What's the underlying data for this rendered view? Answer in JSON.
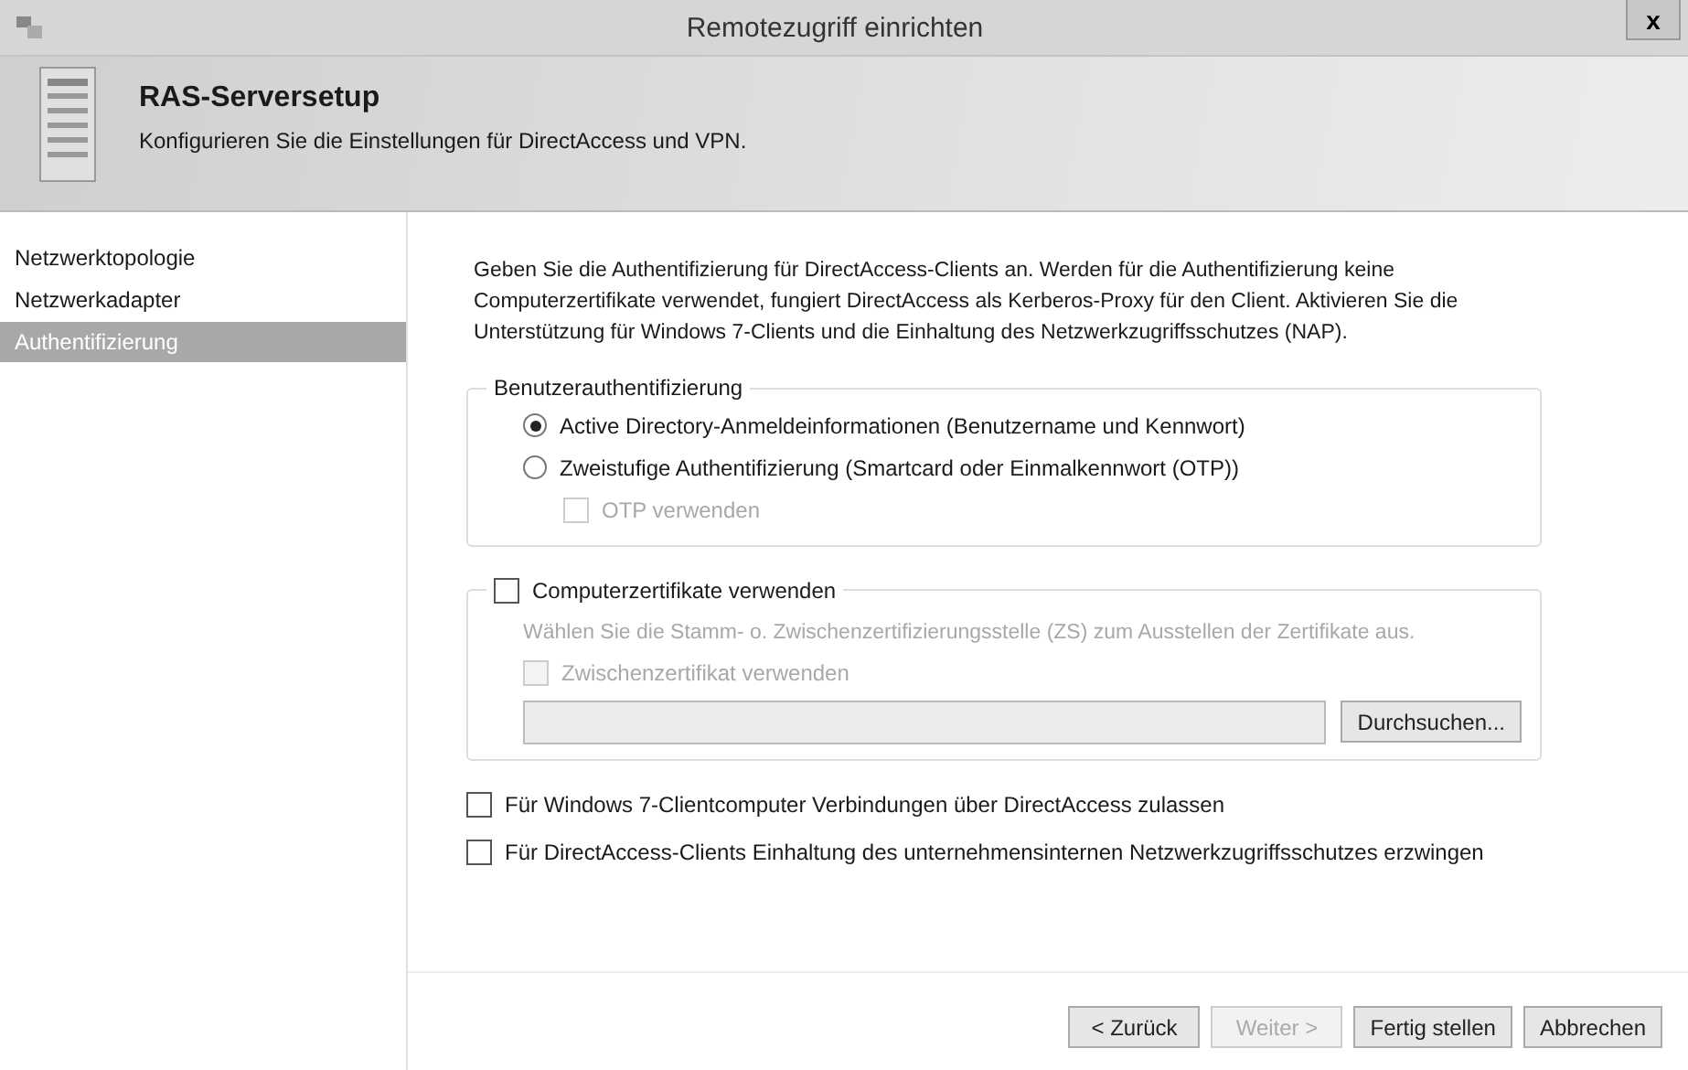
{
  "window": {
    "title": "Remotezugriff einrichten",
    "close": "x"
  },
  "header": {
    "title": "RAS-Serversetup",
    "subtitle": "Konfigurieren Sie die Einstellungen für DirectAccess und VPN."
  },
  "sidebar": {
    "items": [
      {
        "label": "Netzwerktopologie",
        "selected": false
      },
      {
        "label": "Netzwerkadapter",
        "selected": false
      },
      {
        "label": "Authentifizierung",
        "selected": true
      }
    ]
  },
  "description": "Geben Sie die Authentifizierung für DirectAccess-Clients an. Werden für die Authentifizierung keine Computerzertifikate verwendet, fungiert DirectAccess als Kerberos-Proxy für den Client. Aktivieren Sie die Unterstützung für Windows 7-Clients und die Einhaltung des Netzwerkzugriffsschutzes (NAP).",
  "user_auth": {
    "legend": "Benutzerauthentifizierung",
    "options": [
      {
        "label": "Active Directory-Anmeldeinformationen (Benutzername und Kennwort)",
        "selected": true
      },
      {
        "label": "Zweistufige Authentifizierung (Smartcard oder Einmalkennwort (OTP))",
        "selected": false
      }
    ],
    "otp": {
      "label": "OTP verwenden",
      "checked": false,
      "disabled": true
    }
  },
  "certificates": {
    "label": "Computerzertifikate verwenden",
    "checked": false,
    "hint": "Wählen Sie die Stamm- o. Zwischenzertifizierungsstelle (ZS) zum Ausstellen der Zertifikate aus.",
    "intermediate": {
      "label": "Zwischenzertifikat verwenden",
      "checked": false,
      "disabled": true
    },
    "browse": {
      "label": "Durchsuchen...",
      "disabled": false
    },
    "field_disabled": true
  },
  "options": [
    {
      "label": "Für Windows 7-Clientcomputer Verbindungen über DirectAccess zulassen",
      "checked": false
    },
    {
      "label": "Für DirectAccess-Clients Einhaltung des unternehmensinternen Netzwerkzugriffsschutzes erzwingen",
      "checked": false
    }
  ],
  "buttons": [
    {
      "label": "< Zurück",
      "disabled": false
    },
    {
      "label": "Weiter >",
      "disabled": true
    },
    {
      "label": "Fertig stellen",
      "disabled": false
    },
    {
      "label": "Abbrechen",
      "disabled": false
    }
  ]
}
